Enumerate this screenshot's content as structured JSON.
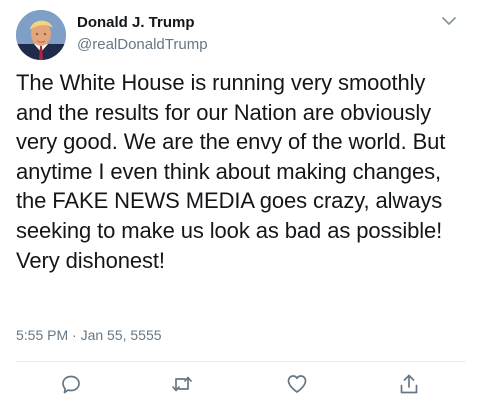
{
  "tweet": {
    "author": {
      "name": "Donald J. Trump",
      "handle": "@realDonaldTrump",
      "avatar": "profile-photo"
    },
    "text": "The White House is running very smoothly and the results for our Nation are obviously very good. We are the envy of the world. But anytime I even think about making changes, the FAKE NEWS MEDIA goes crazy, always seeking to make us look as bad as possible! Very dishonest!",
    "timestamp": "5:55 PM · Jan 55, 5555"
  },
  "actions": [
    {
      "name": "reply",
      "icon": "reply-icon"
    },
    {
      "name": "retweet",
      "icon": "retweet-icon"
    },
    {
      "name": "like",
      "icon": "heart-icon"
    },
    {
      "name": "share",
      "icon": "share-icon"
    }
  ],
  "colors": {
    "primary_text": "#14171a",
    "secondary_text": "#657786",
    "divider": "#e6ecf0",
    "icon": "#657786"
  }
}
